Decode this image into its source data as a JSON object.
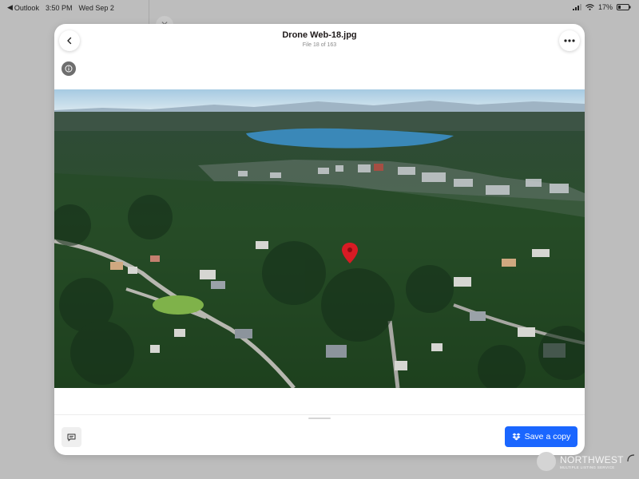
{
  "status_bar": {
    "back_app": "Outlook",
    "time": "3:50 PM",
    "date": "Wed Sep 2",
    "battery": "17%"
  },
  "viewer": {
    "title": "Drone Web-18.jpg",
    "subtitle": "File 18 of 163",
    "save_label": "Save a copy",
    "icons": {
      "back": "chevron-left-icon",
      "more": "more-horizontal-icon",
      "info": "info-icon",
      "comment": "comment-icon",
      "save": "dropbox-icon"
    }
  },
  "watermark": {
    "title": "NORTHWEST",
    "subtitle": "MULTIPLE LISTING SERVICE"
  },
  "colors": {
    "accent": "#1a66ff",
    "pin": "#d81b24",
    "lake": "#3a88b8",
    "sky": "#c2dcec"
  }
}
